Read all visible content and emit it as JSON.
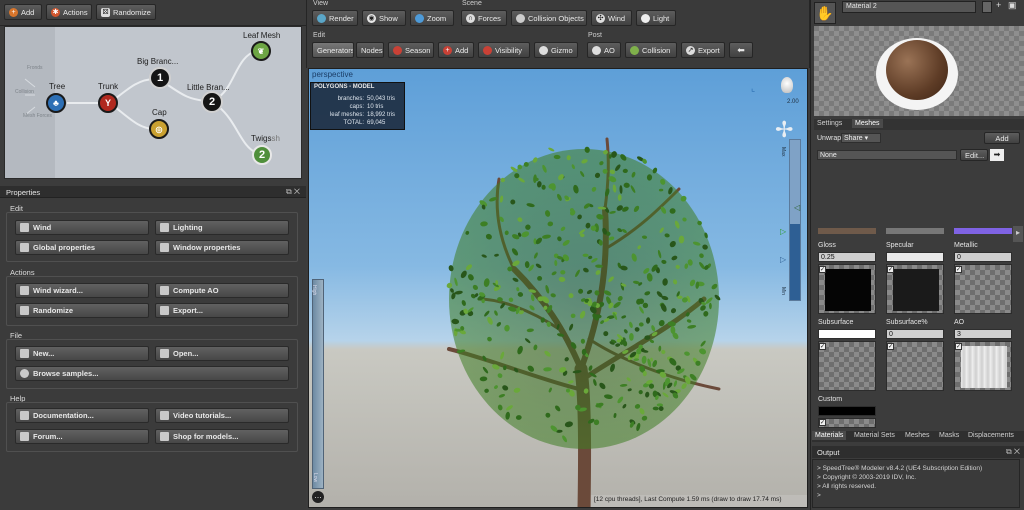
{
  "toolbar": {
    "add": "Add",
    "actions": "Actions",
    "randomize": "Randomize"
  },
  "view_group": {
    "label": "View",
    "render": "Render",
    "show": "Show",
    "zoom": "Zoom"
  },
  "scene_group": {
    "label": "Scene",
    "forces": "Forces",
    "collision_objects": "Collision Objects",
    "wind": "Wind",
    "light": "Light"
  },
  "edit_group": {
    "label": "Edit",
    "generators": "Generators",
    "nodes": "Nodes",
    "season": "Season",
    "add": "Add",
    "visibility": "Visibility",
    "gizmo": "Gizmo"
  },
  "post_group": {
    "label": "Post",
    "ao": "AO",
    "collision": "Collision",
    "export": "Export"
  },
  "graph": {
    "faded": [
      "Fronds",
      "Collision",
      "Mesh Forces"
    ],
    "tree": "Tree",
    "trunk": "Trunk",
    "big_branches": "Big Branc...",
    "big_branches_num": "1",
    "little_branches": "Little Bran...",
    "little_branches_num": "2",
    "cap": "Cap",
    "leaf_mesh": "Leaf Mesh",
    "twigs": "Twigs",
    "twigs_suffix": "sh",
    "twigs_num": "2"
  },
  "properties": {
    "title": "Properties",
    "edit_label": "Edit",
    "wind": "Wind",
    "lighting": "Lighting",
    "global_properties": "Global properties",
    "window_properties": "Window properties",
    "actions_label": "Actions",
    "wind_wizard": "Wind wizard...",
    "compute_ao": "Compute AO",
    "randomize": "Randomize",
    "export": "Export...",
    "file_label": "File",
    "new": "New...",
    "open": "Open...",
    "browse_samples": "Browse samples...",
    "help_label": "Help",
    "documentation": "Documentation...",
    "video_tutorials": "Video tutorials...",
    "forum": "Forum...",
    "shop": "Shop for models..."
  },
  "viewport": {
    "label": "perspective",
    "stats_title": "POLYGONS - MODEL",
    "stats": [
      {
        "label": "branches:",
        "value": "50,043 tris"
      },
      {
        "label": "caps:",
        "value": "10 tris"
      },
      {
        "label": "leaf meshes:",
        "value": "18,992 tris"
      },
      {
        "label": "TOTAL:",
        "value": "69,045"
      }
    ],
    "light_value": "2.00",
    "slider_left_high": "High",
    "slider_left_low": "Low",
    "slider_right_max": "Max",
    "slider_right_min": "Min",
    "status": "[12 cpu threads], Last Compute 1.59 ms (draw to draw 17.74 ms)"
  },
  "material": {
    "name": "Material 2",
    "tab_settings": "Settings",
    "tab_meshes": "Meshes",
    "unwrap_label": "Unwrap",
    "unwrap_value": "Share",
    "add": "Add",
    "map_value": "None",
    "edit": "Edit...",
    "gloss_label": "Gloss",
    "gloss_value": "0.25",
    "specular_label": "Specular",
    "metallic_label": "Metallic",
    "metallic_value": "0",
    "subsurface_label": "Subsurface",
    "subsurface_pct_label": "Subsurface%",
    "subsurface_pct_value": "0",
    "ao_label": "AO",
    "ao_value": "3",
    "custom_label": "Custom",
    "bottom_tabs": [
      "Materials",
      "Material Sets",
      "Meshes",
      "Masks",
      "Displacements"
    ]
  },
  "output": {
    "title": "Output",
    "lines": [
      "> SpeedTree® Modeler v8.4.2 (UE4 Subscription Edition)",
      "> Copyright © 2003-2019 IDV, Inc.",
      "> All rights reserved.",
      ">"
    ]
  },
  "colors": {
    "sky_top": "#5e9fd8",
    "ground": "#b3b1ab",
    "accent_blue": "#4b8fd6"
  }
}
